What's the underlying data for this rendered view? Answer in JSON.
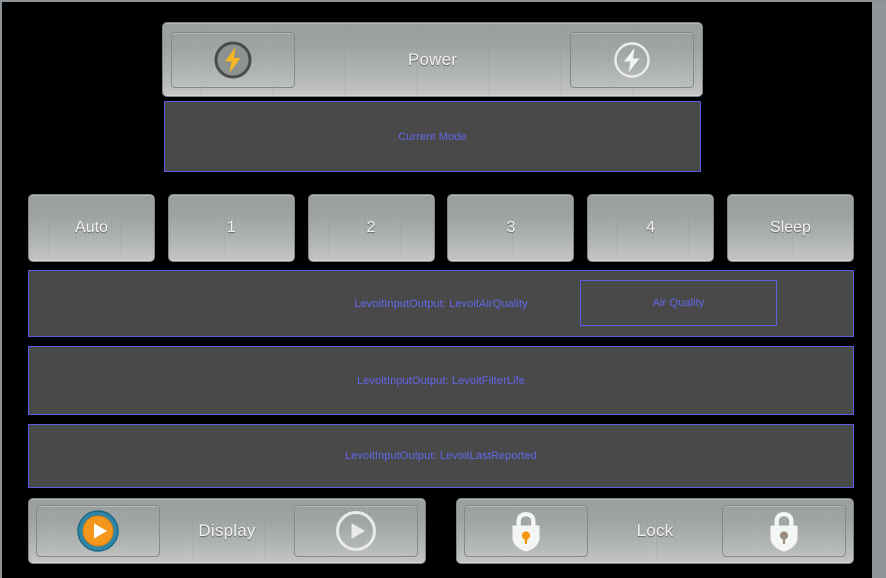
{
  "window": {
    "background_color": "#000000",
    "frame_border_color": "#8c9296",
    "scrollbar_color": "#909598"
  },
  "theme": {
    "metal_light": "#c3c6c3",
    "metal_dark": "#9a9e9e",
    "panel_fill": "#494949",
    "accent_blue": "#5a5be0",
    "label_blue": "#6366e8",
    "text_white": "#f0f0f0",
    "icon_orange": "#f59b1c",
    "icon_teal": "#2a7f9e",
    "icon_gray": "#8f9391"
  },
  "power_bar": {
    "label": "Power",
    "on_icon": "power-bolt-on-icon",
    "off_icon": "power-bolt-off-icon"
  },
  "current_mode": {
    "label": "Current Mode"
  },
  "modes": [
    {
      "label": "Auto",
      "name": "mode-auto"
    },
    {
      "label": "1",
      "name": "mode-1"
    },
    {
      "label": "2",
      "name": "mode-2"
    },
    {
      "label": "3",
      "name": "mode-3"
    },
    {
      "label": "4",
      "name": "mode-4"
    },
    {
      "label": "Sleep",
      "name": "mode-sleep"
    }
  ],
  "status_panels": {
    "air_quality": {
      "label": "LevoitInputOutput: LevoitAirQuality",
      "sub_label": "Air Quality"
    },
    "filter_life": {
      "label": "LevoitInputOutput: LevoitFilterLife"
    },
    "last_reported": {
      "label": "LevoitInputOutput: LevoitLastReported"
    }
  },
  "display_bar": {
    "label": "Display",
    "on_icon": "play-circle-on-icon",
    "off_icon": "play-circle-off-icon"
  },
  "lock_bar": {
    "label": "Lock",
    "on_icon": "lock-closed-on-icon",
    "off_icon": "lock-closed-off-icon"
  }
}
